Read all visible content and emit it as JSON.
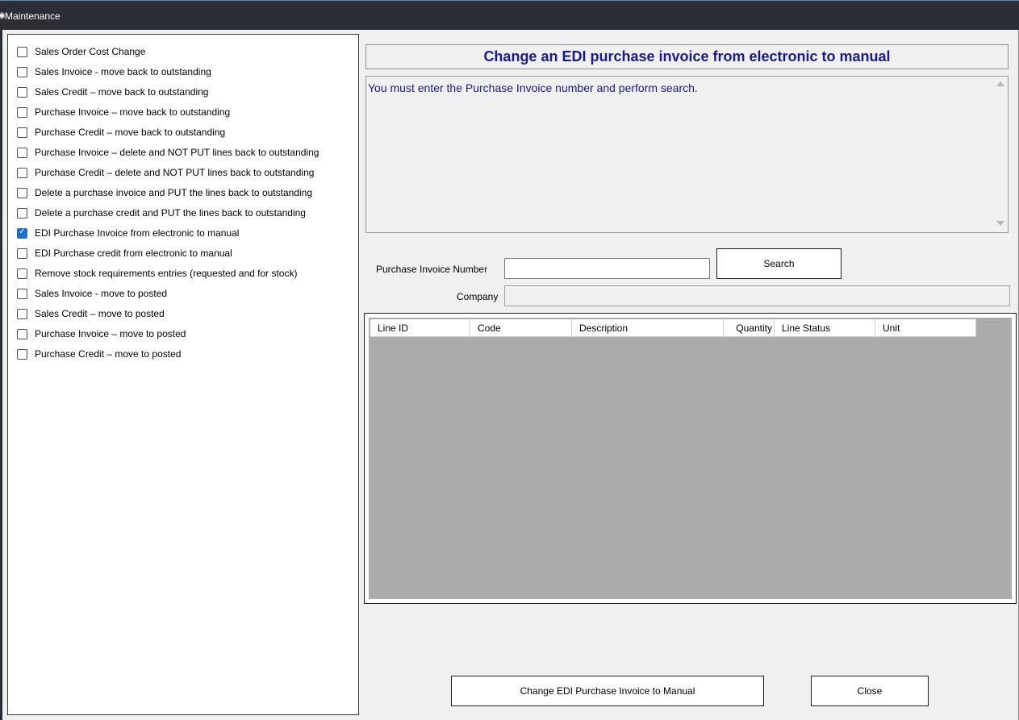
{
  "window": {
    "title": "Maintenance",
    "icon": "app-icon"
  },
  "options": [
    {
      "label": "Sales Order Cost Change",
      "checked": false
    },
    {
      "label": "Sales Invoice - move back to outstanding",
      "checked": false
    },
    {
      "label": "Sales Credit – move back to outstanding",
      "checked": false
    },
    {
      "label": "Purchase Invoice – move back to outstanding",
      "checked": false
    },
    {
      "label": "Purchase Credit – move back to outstanding",
      "checked": false
    },
    {
      "label": "Purchase Invoice – delete and NOT PUT lines back to outstanding",
      "checked": false
    },
    {
      "label": "Purchase Credit – delete and NOT PUT lines back to outstanding",
      "checked": false
    },
    {
      "label": "Delete a purchase invoice and PUT the lines back to outstanding",
      "checked": false
    },
    {
      "label": "Delete a purchase credit and PUT the lines back to outstanding",
      "checked": false
    },
    {
      "label": "EDI Purchase Invoice from electronic to manual",
      "checked": true
    },
    {
      "label": "EDI Purchase credit from electronic to manual",
      "checked": false
    },
    {
      "label": "Remove stock requirements entries (requested and for stock)",
      "checked": false
    },
    {
      "label": "Sales Invoice - move to posted",
      "checked": false
    },
    {
      "label": "Sales Credit – move to posted",
      "checked": false
    },
    {
      "label": "Purchase Invoice – move to posted",
      "checked": false
    },
    {
      "label": "Purchase Credit – move to posted",
      "checked": false
    }
  ],
  "main": {
    "header": "Change an EDI purchase invoice from electronic to manual",
    "info_text": "You must enter the Purchase Invoice number and perform search.",
    "purchase_invoice_label": "Purchase Invoice Number",
    "purchase_invoice_value": "",
    "company_label": "Company",
    "company_value": "",
    "search_button": "Search",
    "grid_columns": [
      "Line ID",
      "Code",
      "Description",
      "Quantity",
      "Line Status",
      "Unit"
    ],
    "change_button": "Change EDI Purchase Invoice to Manual",
    "close_button": "Close"
  },
  "colors": {
    "title_bar": "#2b2f35",
    "heading_text": "#1a1a8c",
    "check_accent": "#1f6fcf",
    "grid_background": "#ababab"
  }
}
